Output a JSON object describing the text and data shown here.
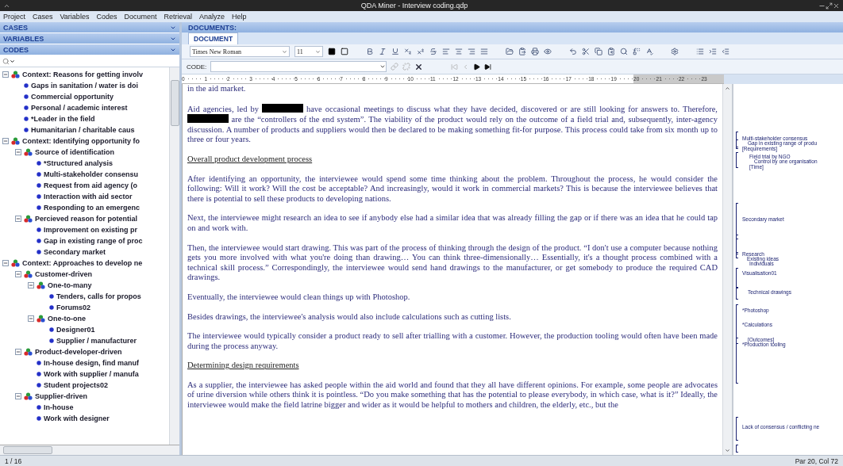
{
  "window": {
    "title": "QDA Miner - Interview coding.qdp"
  },
  "menu": [
    "Project",
    "Cases",
    "Variables",
    "Codes",
    "Document",
    "Retrieval",
    "Analyze",
    "Help"
  ],
  "left_panel": {
    "sections": [
      {
        "label": "CASES"
      },
      {
        "label": "VARIABLES"
      },
      {
        "label": "CODES"
      }
    ],
    "codes_tree": [
      {
        "label": "Context: Reasons for getting involv",
        "expanded": true,
        "children": [
          {
            "label": "Gaps in sanitation / water is doi"
          },
          {
            "label": "Commercial opportunity"
          },
          {
            "label": "Personal / academic interest"
          },
          {
            "label": "*Leader in the field"
          },
          {
            "label": "Humanitarian / charitable caus"
          }
        ]
      },
      {
        "label": "Context: Identifying opportunity fo",
        "expanded": true,
        "children": [
          {
            "label": "Source of identification",
            "expanded": true,
            "children": [
              {
                "label": "*Structured analysis"
              },
              {
                "label": "Multi-stakeholder consensu"
              },
              {
                "label": "Request from aid agency (o"
              },
              {
                "label": "Interaction with aid sector"
              },
              {
                "label": "Responding to an emergenc"
              }
            ]
          },
          {
            "label": "Percieved reason for potential",
            "expanded": true,
            "children": [
              {
                "label": "Improvement on existing pr"
              },
              {
                "label": "Gap in existing range of proc"
              },
              {
                "label": "Secondary market"
              }
            ]
          }
        ]
      },
      {
        "label": "Context: Approaches to develop ne",
        "expanded": true,
        "children": [
          {
            "label": "Customer-driven",
            "expanded": true,
            "children": [
              {
                "label": "One-to-many",
                "expanded": true,
                "children": [
                  {
                    "label": "Tenders, calls for propos"
                  },
                  {
                    "label": "Forums02"
                  }
                ]
              },
              {
                "label": "One-to-one",
                "expanded": true,
                "children": [
                  {
                    "label": "Designer01"
                  },
                  {
                    "label": "Supplier / manufacturer"
                  }
                ]
              }
            ]
          },
          {
            "label": "Product-developer-driven",
            "expanded": true,
            "children": [
              {
                "label": "In-house design, find manuf"
              },
              {
                "label": "Work with supplier / manufa"
              },
              {
                "label": "Student projects02"
              }
            ]
          },
          {
            "label": "Supplier-driven",
            "expanded": true,
            "children": [
              {
                "label": "In-house"
              },
              {
                "label": "Work with designer"
              }
            ]
          }
        ]
      }
    ]
  },
  "documents": {
    "header": "DOCUMENTS:",
    "tabs": [
      {
        "label": "DOCUMENT",
        "selected": true
      }
    ],
    "toolbar": {
      "font": "Times New Roman",
      "size": "11"
    },
    "code_bar": {
      "label": "CODE:"
    },
    "ruler": [
      "0",
      "1",
      "2",
      "3",
      "4",
      "5",
      "6",
      "7",
      "8",
      "9",
      "10",
      "11",
      "12",
      "13",
      "14",
      "15",
      "16",
      "17",
      "18",
      "19",
      "20",
      "21",
      "22",
      "23"
    ],
    "paragraphs": [
      {
        "kind": "body",
        "parts": [
          {
            "text": "in the aid market."
          }
        ]
      },
      {
        "kind": "body",
        "parts": [
          {
            "text": "Aid agencies, led by "
          },
          {
            "redacted": true
          },
          {
            "text": " have occasional meetings to discuss what they have decided, discovered or are still looking for answers to. Therefore, "
          },
          {
            "redacted": true
          },
          {
            "text": " are the “controllers of the end system”. The viability of the product would rely on the outcome of a field trial and, subsequently, inter-agency discussion. A number of products and suppliers would then be declared to be making something fit-for purpose. This process could take from six month up to three or four years."
          }
        ]
      },
      {
        "kind": "heading",
        "parts": [
          {
            "text": "Overall product development process"
          }
        ]
      },
      {
        "kind": "body",
        "parts": [
          {
            "text": "After identifying an opportunity, the interviewee would spend some time thinking about the problem. Throughout the process, he would consider the following: Will it work? Will the cost be acceptable? And increasingly, would it work in commercial markets? This is because the interviewee believes that there is potential to sell these products to developing nations."
          }
        ]
      },
      {
        "kind": "body",
        "parts": [
          {
            "text": "Next, the interviewee might research an idea to see if anybody else had a similar idea that was already filling the gap or if there was an idea that he could tap on and work with."
          }
        ]
      },
      {
        "kind": "body",
        "parts": [
          {
            "text": "Then, the interviewee would start drawing. This was part of the process of thinking through the design of the product. “I don't use a computer because nothing gets you more involved with what you're doing than drawing… You can think three-dimensionally… Essentially, it's a thought process combined with a technical skill process.” Correspondingly, the interviewee would send hand drawings to the manufacturer, or get somebody to produce the required CAD drawings."
          }
        ]
      },
      {
        "kind": "body",
        "parts": [
          {
            "text": "Eventually, the interviewee would clean things up with Photoshop."
          }
        ]
      },
      {
        "kind": "body",
        "parts": [
          {
            "text": "Besides drawings, the interviewee's analysis would also include calculations such as cutting lists."
          }
        ]
      },
      {
        "kind": "body",
        "parts": [
          {
            "text": "The interviewee would typically consider a product ready to sell after trialling with a customer. However, the production tooling would often have been made during the process anyway."
          }
        ]
      },
      {
        "kind": "heading",
        "parts": [
          {
            "text": "Determining design requirements"
          }
        ]
      },
      {
        "kind": "body",
        "parts": [
          {
            "text": "As a supplier, the interviewee has asked people within the aid world and found that they all have different opinions. For example, some people are advocates of urine diversion while others think it is pointless. “Do you make something that has the potential to please everybody, in which case, what is it?” Ideally, the interviewee would make the field latrine bigger and wider as it would be helpful to mothers and children, the elderly, etc., but the"
          }
        ]
      }
    ],
    "margin_codes": [
      "Multi-stakeholder consensus",
      "Gap in existing range of produ",
      "[Requirements]",
      "Field trial by NGO",
      "Control by one organisation",
      "[Time]",
      "Secondary market",
      "Research",
      "Existing ideas",
      "Individuals",
      "Visualisation01",
      "Technical drawings",
      "*Photoshop",
      "*Calculations",
      "[Outcomes]",
      "*Production tooling",
      "Lack of consensus / conflicting ne"
    ]
  },
  "status_bar": {
    "left": "1 / 16",
    "right": "Par 20, Col 72"
  }
}
